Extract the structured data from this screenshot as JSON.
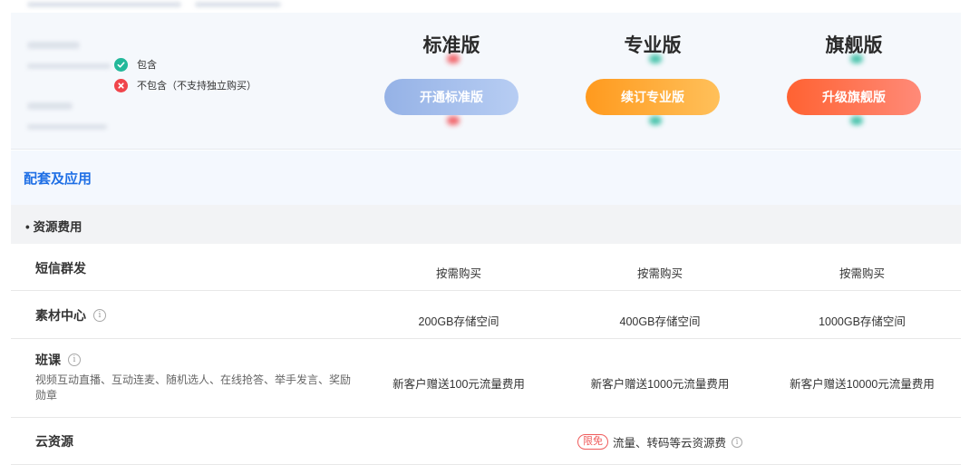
{
  "legend": {
    "included": "包含",
    "excluded": "不包含（不支持独立购买）"
  },
  "plans": [
    {
      "title": "标准版",
      "button": "开通标准版"
    },
    {
      "title": "专业版",
      "button": "续订专业版"
    },
    {
      "title": "旗舰版",
      "button": "升级旗舰版"
    }
  ],
  "section": {
    "title": "配套及应用",
    "subsection": "• 资源费用"
  },
  "rows": {
    "sms": {
      "label": "短信群发",
      "values": [
        "按需购买",
        "按需购买",
        "按需购买"
      ]
    },
    "material": {
      "label": "素材中心",
      "values": [
        "200GB存储空间",
        "400GB存储空间",
        "1000GB存储空间"
      ]
    },
    "class": {
      "label": "班课",
      "desc": "视频互动直播、互动连麦、随机选人、在线抢答、举手发言、奖励勋章",
      "values": [
        "新客户赠送100元流量费用",
        "新客户赠送1000元流量费用",
        "新客户赠送10000元流量费用"
      ]
    },
    "cloud": {
      "label": "云资源",
      "badge": "限免",
      "note": "流量、转码等云资源费"
    }
  },
  "info_glyph": "i",
  "colors": {
    "accent": "#1f6fe5",
    "included": "#23b89a",
    "excluded": "#f0454b",
    "standard_btn": "#95b2e6",
    "pro_btn": "#ff9a1e",
    "flagship_btn": "#ff6232"
  }
}
